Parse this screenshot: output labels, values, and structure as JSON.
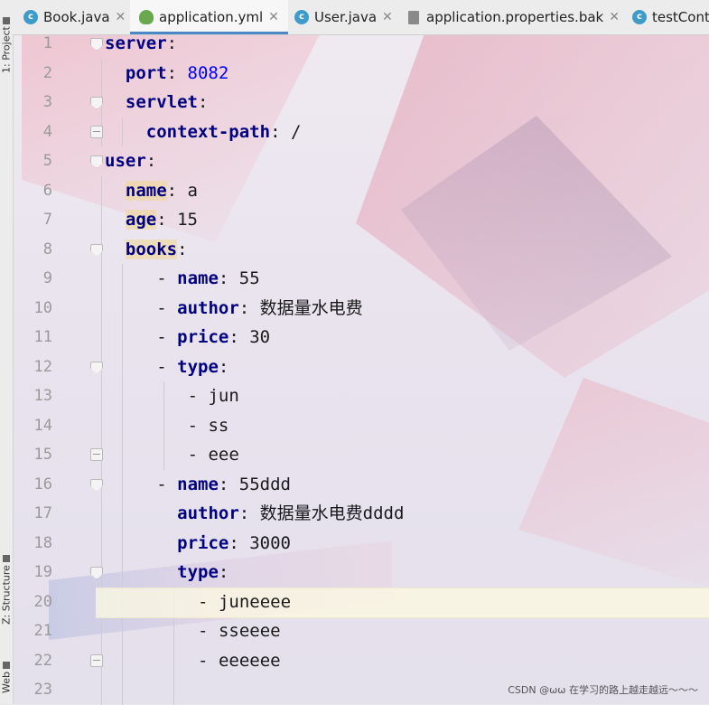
{
  "tabs": [
    {
      "label": "Book.java",
      "icon": "class-icon",
      "active": false,
      "closable": true
    },
    {
      "label": "application.yml",
      "icon": "yml-icon",
      "active": true,
      "closable": true
    },
    {
      "label": "User.java",
      "icon": "class-icon",
      "active": false,
      "closable": true
    },
    {
      "label": "application.properties.bak",
      "icon": "file-icon",
      "active": false,
      "closable": true
    },
    {
      "label": "testCont",
      "icon": "class-icon",
      "active": false,
      "closable": false
    }
  ],
  "toolwindows": {
    "project": "1: Project",
    "structure": "Z: Structure",
    "web": "Web"
  },
  "editor": {
    "current_line": 20,
    "lines": [
      {
        "n": "1",
        "indent": 0,
        "key": "server",
        "colon": ":",
        "value": "",
        "fold": "open"
      },
      {
        "n": "2",
        "indent": 2,
        "key": "port",
        "colon": ":",
        "value": "8082",
        "value_type": "number"
      },
      {
        "n": "3",
        "indent": 2,
        "key": "servlet",
        "colon": ":",
        "value": "",
        "fold": "open"
      },
      {
        "n": "4",
        "indent": 4,
        "key": "context-path",
        "colon": ":",
        "value": "/",
        "fold": "close"
      },
      {
        "n": "5",
        "indent": 0,
        "key": "user",
        "colon": ":",
        "value": "",
        "fold": "open"
      },
      {
        "n": "6",
        "indent": 2,
        "key": "name",
        "colon": ":",
        "value": "a",
        "highlight": true
      },
      {
        "n": "7",
        "indent": 2,
        "key": "age",
        "colon": ":",
        "value": "15",
        "highlight": true
      },
      {
        "n": "8",
        "indent": 2,
        "key": "books",
        "colon": ":",
        "value": "",
        "highlight": true,
        "fold": "open"
      },
      {
        "n": "9",
        "indent": 5,
        "dash": "- ",
        "key": "name",
        "colon": ":",
        "value": "55"
      },
      {
        "n": "10",
        "indent": 5,
        "dash": "- ",
        "key": "author",
        "colon": ":",
        "value": "数据量水电费"
      },
      {
        "n": "11",
        "indent": 5,
        "dash": "- ",
        "key": "price",
        "colon": ":",
        "value": "30"
      },
      {
        "n": "12",
        "indent": 5,
        "dash": "- ",
        "key": "type",
        "colon": ":",
        "value": "",
        "fold": "open"
      },
      {
        "n": "13",
        "indent": 8,
        "dash": "- ",
        "key": "",
        "colon": "",
        "value": "jun"
      },
      {
        "n": "14",
        "indent": 8,
        "dash": "- ",
        "key": "",
        "colon": "",
        "value": "ss"
      },
      {
        "n": "15",
        "indent": 8,
        "dash": "- ",
        "key": "",
        "colon": "",
        "value": "eee",
        "fold": "close"
      },
      {
        "n": "16",
        "indent": 5,
        "dash": "- ",
        "key": "name",
        "colon": ":",
        "value": "55ddd",
        "fold": "open"
      },
      {
        "n": "17",
        "indent": 7,
        "key": "author",
        "colon": ":",
        "value": "数据量水电费dddd"
      },
      {
        "n": "18",
        "indent": 7,
        "key": "price",
        "colon": ":",
        "value": "3000"
      },
      {
        "n": "19",
        "indent": 7,
        "key": "type",
        "colon": ":",
        "value": "",
        "fold": "open"
      },
      {
        "n": "20",
        "indent": 9,
        "dash": "- ",
        "key": "",
        "colon": "",
        "value": "juneeee"
      },
      {
        "n": "21",
        "indent": 9,
        "dash": "- ",
        "key": "",
        "colon": "",
        "value": "sseeee"
      },
      {
        "n": "22",
        "indent": 9,
        "dash": "- ",
        "key": "",
        "colon": "",
        "value": "eeeeee",
        "fold": "close"
      },
      {
        "n": "23",
        "indent": 0,
        "key": "",
        "colon": "",
        "value": ""
      }
    ]
  },
  "watermark": "CSDN @ωω 在学习的路上越走越远～～～"
}
